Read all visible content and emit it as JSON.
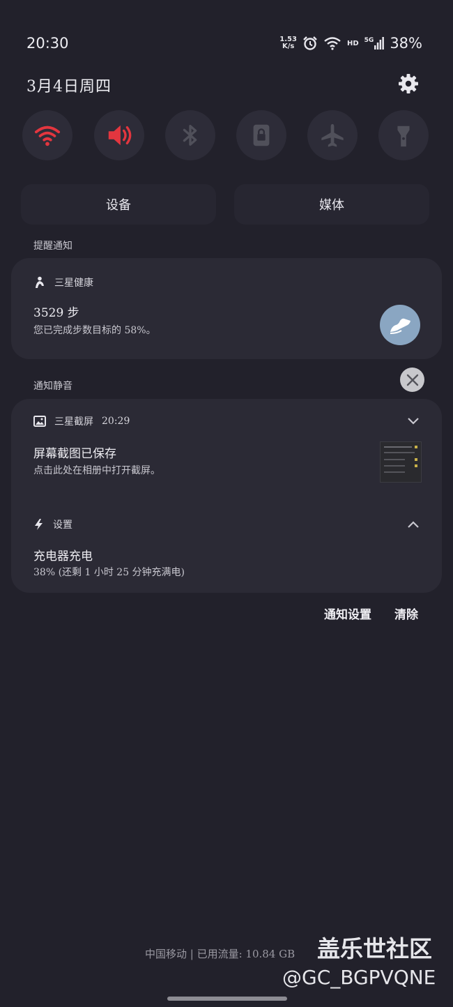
{
  "status_bar": {
    "time": "20:30",
    "net_speed_value": "1.53",
    "net_speed_unit": "K/s",
    "hd_label": "HD",
    "signal_label": "5G",
    "battery": "38%",
    "icons": [
      "alarm-icon",
      "wifi-icon",
      "cellular-icon"
    ]
  },
  "header": {
    "date": "3月4日周四",
    "settings_icon": "gear-icon"
  },
  "quick_toggles": [
    {
      "name": "wifi",
      "icon": "wifi-icon",
      "active": true
    },
    {
      "name": "sound",
      "icon": "speaker-icon",
      "active": true
    },
    {
      "name": "bluetooth",
      "icon": "bluetooth-icon",
      "active": false
    },
    {
      "name": "rotation-lock",
      "icon": "lock-icon",
      "active": false
    },
    {
      "name": "airplane-mode",
      "icon": "airplane-icon",
      "active": false
    },
    {
      "name": "flashlight",
      "icon": "flashlight-icon",
      "active": false
    }
  ],
  "colors": {
    "accent_active": "#e3363f",
    "inactive_icon": "#50505a",
    "background": "#22212b",
    "card": "#2b2a35"
  },
  "output_buttons": {
    "device": "设备",
    "media": "媒体"
  },
  "sections": {
    "alerts": "提醒通知",
    "silent": "通知静音"
  },
  "health": {
    "app_name": "三星健康",
    "steps": "3529 步",
    "progress_text": "您已完成步数目标的 58%。",
    "progress_percent": 58
  },
  "screenshot_notif": {
    "app_name": "三星截屏",
    "time": "20:29",
    "title": "屏幕截图已保存",
    "text": "点击此处在相册中打开截屏。"
  },
  "charging_notif": {
    "app_name": "设置",
    "title": "充电器充电",
    "text": "38% (还剩 1 小时 25 分钟充满电)"
  },
  "actions": {
    "notification_settings": "通知设置",
    "clear": "清除"
  },
  "footer": {
    "carrier_usage": "中国移动 | 已用流量: 10.84 GB",
    "watermark_title": "盖乐世社区",
    "watermark_user": "@GC_BGPVQNE"
  }
}
